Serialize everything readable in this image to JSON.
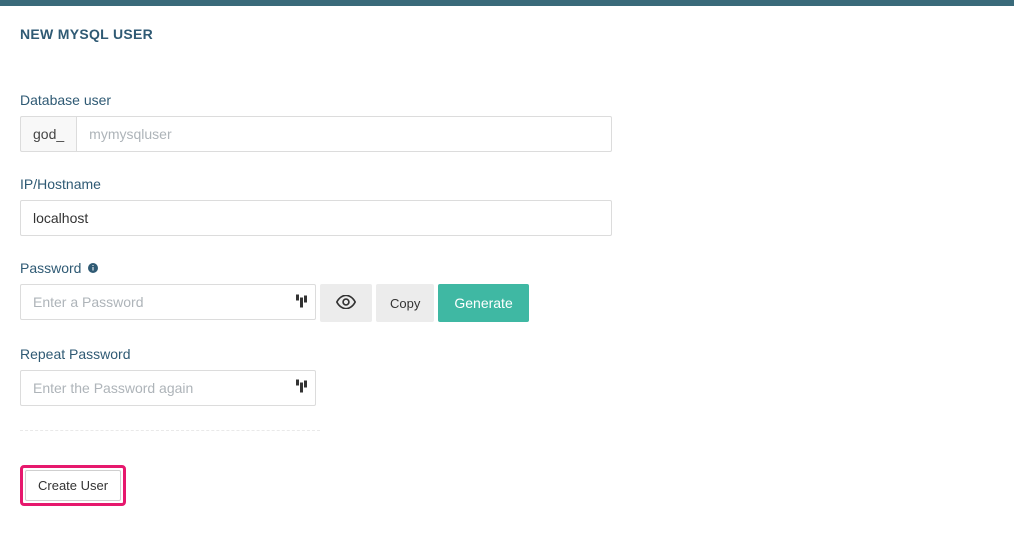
{
  "page": {
    "title": "NEW MYSQL USER"
  },
  "form": {
    "database_user": {
      "label": "Database user",
      "prefix": "god_",
      "placeholder": "mymysqluser",
      "value": ""
    },
    "ip_hostname": {
      "label": "IP/Hostname",
      "value": "localhost"
    },
    "password": {
      "label": "Password",
      "placeholder": "Enter a Password",
      "value": "",
      "visibility_button": "👁",
      "copy_button": "Copy",
      "generate_button": "Generate"
    },
    "repeat_password": {
      "label": "Repeat Password",
      "placeholder": "Enter the Password again",
      "value": ""
    },
    "submit_label": "Create User"
  }
}
